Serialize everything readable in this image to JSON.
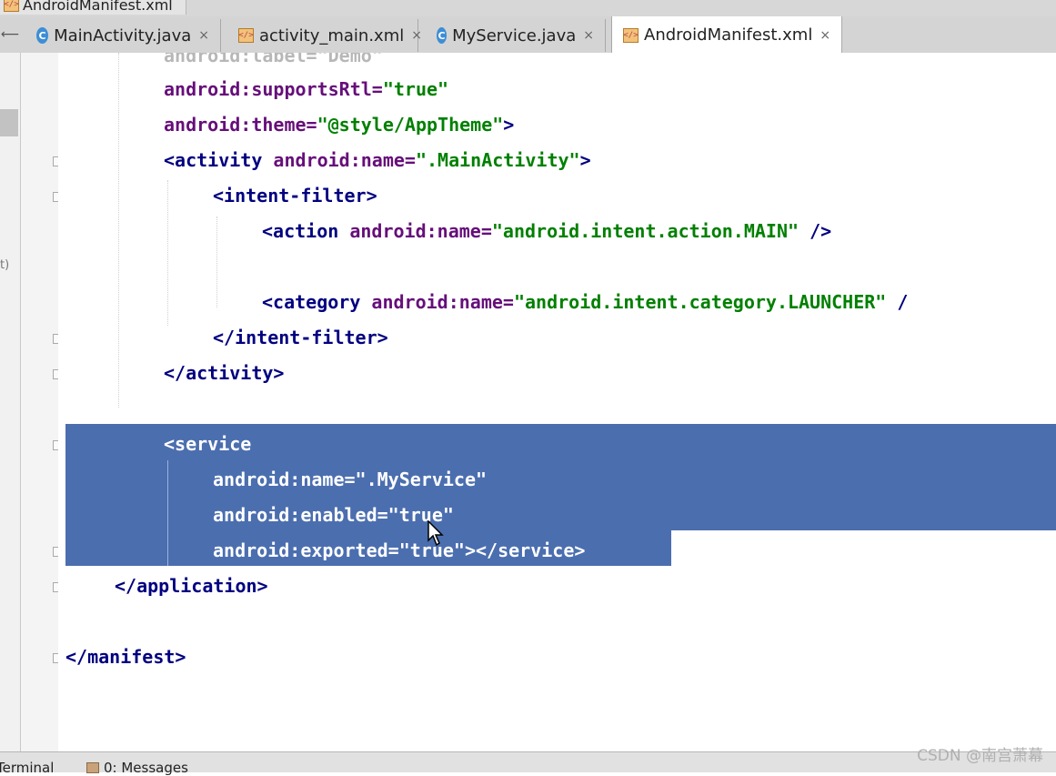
{
  "window": {
    "title_tab": "AndroidManifest.xml"
  },
  "tabs": [
    {
      "label": "MainActivity.java",
      "icon": "java-class-icon",
      "close": "×"
    },
    {
      "label": "activity_main.xml",
      "icon": "xml-file-icon",
      "close": "×"
    },
    {
      "label": "MyService.java",
      "icon": "java-class-icon",
      "close": "×"
    },
    {
      "label": "AndroidManifest.xml",
      "icon": "xml-file-icon",
      "close": "×",
      "active": true
    }
  ],
  "left_strip": {
    "side_text": "t)"
  },
  "code": {
    "line0": "android:label=\"Demo\"",
    "line1_attr": "android:supportsRtl=",
    "line1_val": "\"true\"",
    "line2_attr": "android:theme=",
    "line2_val": "\"@style/AppTheme\"",
    "line2_end": ">",
    "line3_tag": "<activity",
    "line3_attr": " android:name=",
    "line3_val": "\".MainActivity\"",
    "line3_end": ">",
    "line4": "<intent-filter>",
    "line5_tag": "<action",
    "line5_attr": " android:name=",
    "line5_val": "\"android.intent.action.MAIN\"",
    "line5_end": " />",
    "line7_tag": "<category",
    "line7_attr": " android:name=",
    "line7_val": "\"android.intent.category.LAUNCHER\"",
    "line7_end": " /",
    "line8": "</intent-filter>",
    "line9": "</activity>",
    "line11": "<service",
    "line12_attr": "android:name=",
    "line12_val": "\".MyService\"",
    "line13_attr": "android:enabled=",
    "line13_val": "\"true\"",
    "line14_attr": "android:exported=",
    "line14_val": "\"true\"",
    "line14_end": "></service>",
    "line15": "</application>",
    "line17": "</manifest>"
  },
  "status_bar": {
    "terminal": "Terminal",
    "messages": "0: Messages"
  },
  "watermark": "CSDN @南宫萧幕",
  "colors": {
    "selection": "#4b6eaf",
    "tag": "#000080",
    "attribute": "#660e7a",
    "value": "#008000"
  }
}
